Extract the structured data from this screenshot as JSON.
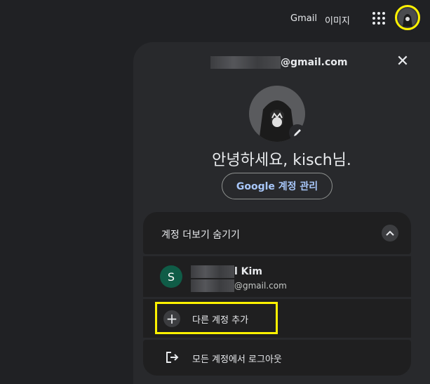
{
  "topbar": {
    "gmail": "Gmail",
    "images": "이미지"
  },
  "panel": {
    "email_domain": "@gmail.com",
    "close_label": "✕",
    "greeting": "안녕하세요, kisch님.",
    "manage_button": "Google 계정 관리",
    "accounts_toggle": "계정 더보기 숨기기",
    "account": {
      "initial": "S",
      "name_suffix": "l Kim",
      "email_domain": "@gmail.com"
    },
    "add_account": "다른 계정 추가",
    "sign_out_all": "모든 계정에서 로그아웃"
  },
  "colors": {
    "highlight": "#fff200",
    "accent": "#a8c7fa",
    "avatar_bg": "#0f5c47"
  }
}
